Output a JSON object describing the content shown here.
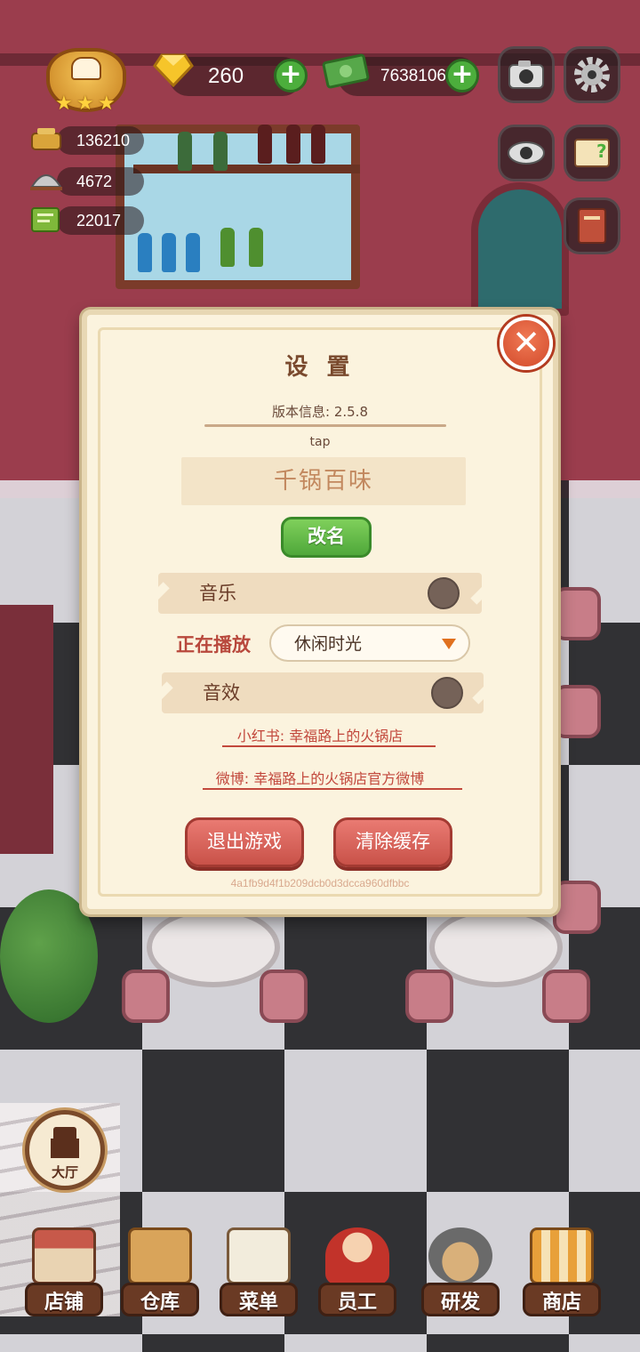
{
  "hud": {
    "gems": "260",
    "cash": "7638106",
    "stats": [
      {
        "icon": "pot-icon",
        "value": "136210"
      },
      {
        "icon": "dish-cover-icon",
        "value": "4672"
      },
      {
        "icon": "ticket-icon",
        "value": "22017"
      }
    ],
    "rank_stars": 3
  },
  "settings": {
    "title": "设 置",
    "version": "版本信息: 2.5.8",
    "account": "tap",
    "player_name": "千锅百味",
    "rename_label": "改名",
    "music_label": "音乐",
    "now_playing_label": "正在播放",
    "now_playing_value": "休闲时光",
    "sfx_label": "音效",
    "xiaohongshu": "小红书: 幸福路上的火锅店",
    "weibo": "微博: 幸福路上的火锅店官方微博",
    "quit_label": "退出游戏",
    "clear_cache_label": "清除缓存",
    "device_id": "4a1fb9d4f1b209dcb0d3dcca960dfbbc",
    "close_glyph": "✕"
  },
  "side": {
    "hall_label": "大厅"
  },
  "nav": [
    {
      "id": "shop",
      "label": "店铺"
    },
    {
      "id": "warehouse",
      "label": "仓库"
    },
    {
      "id": "menu",
      "label": "菜单"
    },
    {
      "id": "staff",
      "label": "员工"
    },
    {
      "id": "research",
      "label": "研发"
    },
    {
      "id": "store",
      "label": "商店"
    }
  ],
  "colors": {
    "dialog_bg": "#fbf3de",
    "accent_red": "#c2483c",
    "button_green": "#4fa83a",
    "wall": "#9b3d4d"
  }
}
